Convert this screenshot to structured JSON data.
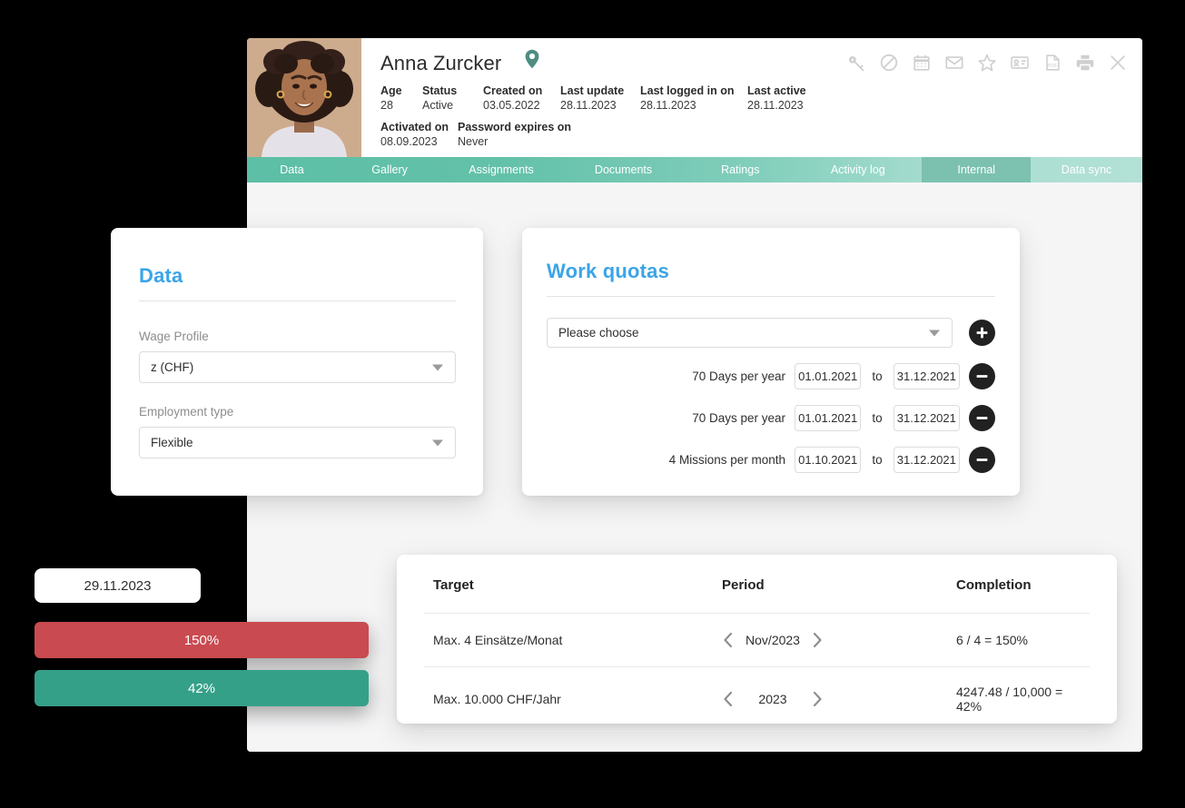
{
  "profile": {
    "name": "Anna Zurcker",
    "pin_icon": "location-pin-icon",
    "meta_row1": [
      {
        "key": "Age",
        "value": "28"
      },
      {
        "key": "Status",
        "value": "Active"
      },
      {
        "key": "Created on",
        "value": "03.05.2022"
      },
      {
        "key": "Last update",
        "value": "28.11.2023"
      },
      {
        "key": "Last logged in on",
        "value": "28.11.2023"
      },
      {
        "key": "Last active",
        "value": "28.11.2023"
      }
    ],
    "meta_row2": [
      {
        "key": "Activated on",
        "value": "08.09.2023"
      },
      {
        "key": "Password expires on",
        "value": "Never"
      }
    ]
  },
  "toolbar": {
    "icons": [
      "key-icon",
      "ban-icon",
      "calendar-icon",
      "envelope-icon",
      "star-icon",
      "id-card-icon",
      "pdf-icon",
      "printer-icon",
      "close-icon"
    ]
  },
  "tabs": [
    {
      "label": "Data",
      "active": false
    },
    {
      "label": "Gallery",
      "active": false
    },
    {
      "label": "Assignments",
      "active": false
    },
    {
      "label": "Documents",
      "active": false
    },
    {
      "label": "Ratings",
      "active": false
    },
    {
      "label": "Activity log",
      "active": false
    },
    {
      "label": "Internal",
      "active": true
    },
    {
      "label": "Data sync",
      "active": false
    }
  ],
  "data_card": {
    "title": "Data",
    "wage_profile": {
      "label": "Wage Profile",
      "value": "z (CHF)"
    },
    "employment_type": {
      "label": "Employment type",
      "value": "Flexible"
    }
  },
  "quota_card": {
    "title": "Work quotas",
    "select_placeholder": "Please choose",
    "add_button": "add-quota-button",
    "to_label": "to",
    "rows": [
      {
        "label": "70 Days per year",
        "from": "01.01.2021",
        "to": "31.12.2021"
      },
      {
        "label": "70 Days per year",
        "from": "01.01.2021",
        "to": "31.12.2021"
      },
      {
        "label": "4 Missions per month",
        "from": "01.10.2021",
        "to": "31.12.2021"
      }
    ]
  },
  "targets_table": {
    "headers": [
      "Target",
      "Period",
      "Completion"
    ],
    "rows": [
      {
        "target": "Max. 4 Einsätze/Monat",
        "period": "Nov/2023",
        "completion": "6 / 4 = 150%"
      },
      {
        "target": "Max. 10.000 CHF/Jahr",
        "period": "2023",
        "completion": "4247.48 / 10,000 = 42%"
      }
    ]
  },
  "float_widget": {
    "date": "29.11.2023",
    "bars": [
      {
        "label": "150%",
        "color": "#c94a50"
      },
      {
        "label": "42%",
        "color": "#35a088"
      }
    ]
  },
  "colors": {
    "accent_blue": "#3ba4e8",
    "tab_teal": "#5cbfa6",
    "tab_teal_light": "#b3e1d6",
    "red": "#c94a50",
    "green": "#35a088",
    "dark_button": "#212121",
    "background": "#000000",
    "app_background": "#f5f5f6"
  }
}
